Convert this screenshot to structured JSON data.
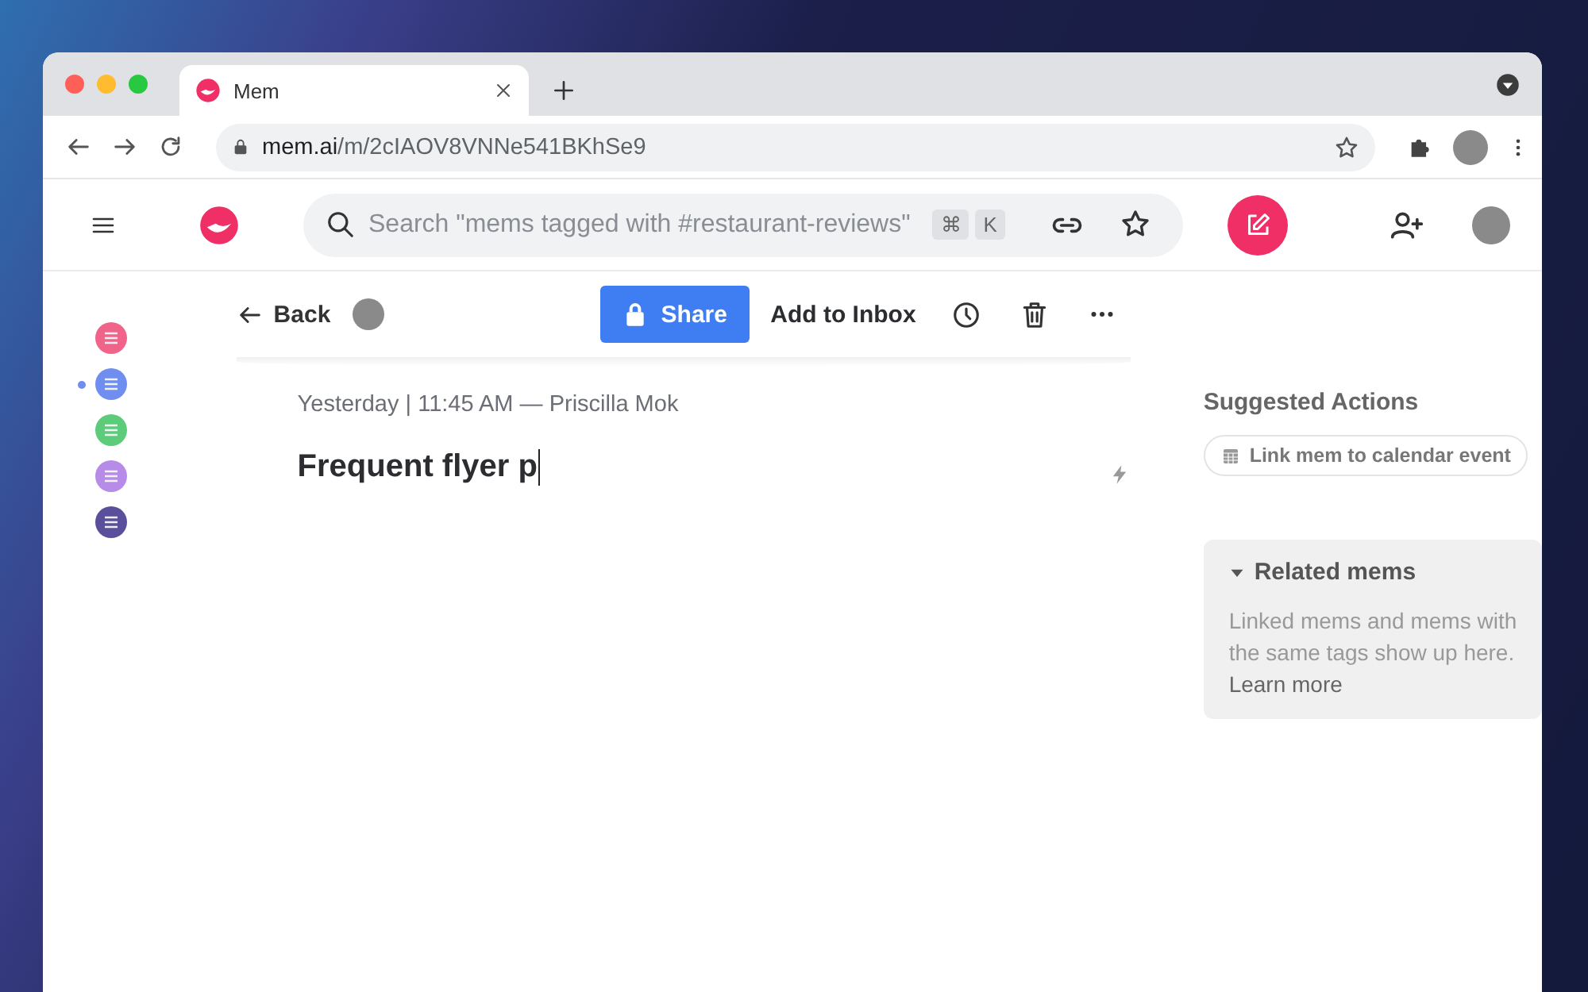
{
  "browser": {
    "tab": {
      "title": "Mem",
      "selected": true
    },
    "url": {
      "host": "mem.ai",
      "path": "/m/2cIAOV8VNNe541BKhSe9"
    }
  },
  "header": {
    "search": {
      "placeholder": "Search \"mems tagged with #restaurant-reviews\"",
      "shortcut": [
        "⌘",
        "K"
      ]
    }
  },
  "sidebar": [
    {
      "color": "#f0648a",
      "selected": false
    },
    {
      "color": "#6f8ef0",
      "selected": true
    },
    {
      "color": "#5ccc7a",
      "selected": false
    },
    {
      "color": "#b78be8",
      "selected": false
    },
    {
      "color": "#5a4f9a",
      "selected": false
    }
  ],
  "toolbar": {
    "back": "Back",
    "share": "Share",
    "add_to_inbox": "Add to Inbox"
  },
  "mem": {
    "meta": "Yesterday | 11:45 AM — Priscilla Mok",
    "title": "Frequent flyer p"
  },
  "suggested_actions": {
    "title": "Suggested Actions",
    "actions": [
      "Link mem to calendar event"
    ]
  },
  "related": {
    "title": "Related mems",
    "expanded": true,
    "text": "Linked mems and mems with the same tags show up here.",
    "link": "Learn more"
  }
}
